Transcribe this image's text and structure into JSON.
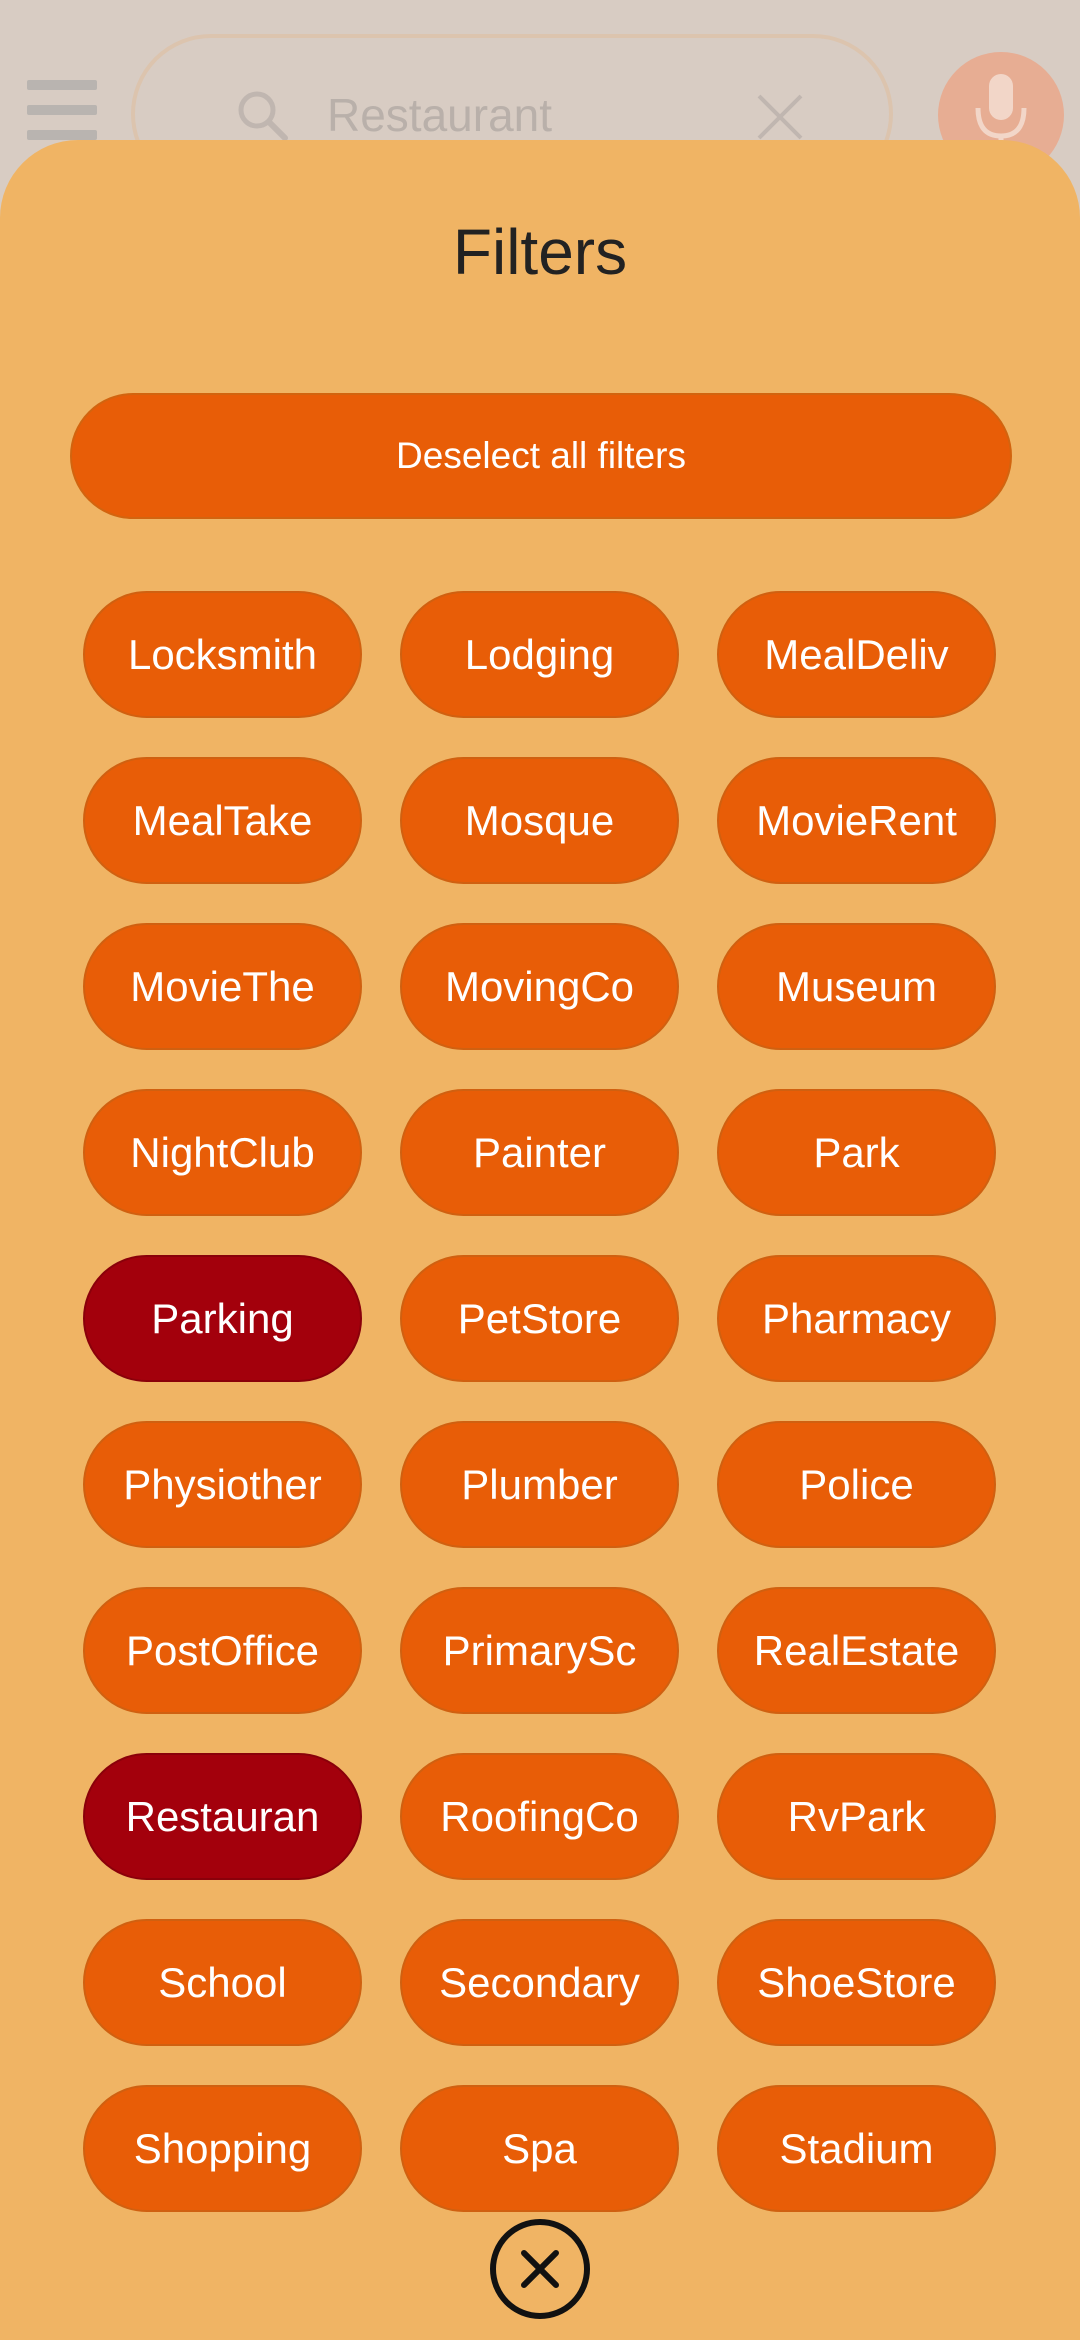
{
  "search": {
    "value": "Restaurant"
  },
  "sheet": {
    "title": "Filters",
    "deselect_label": "Deselect all filters"
  },
  "filters": [
    {
      "label": "Locksmith",
      "selected": false
    },
    {
      "label": "Lodging",
      "selected": false
    },
    {
      "label": "MealDeliv",
      "selected": false
    },
    {
      "label": "MealTake",
      "selected": false
    },
    {
      "label": "Mosque",
      "selected": false
    },
    {
      "label": "MovieRent",
      "selected": false
    },
    {
      "label": "MovieThe",
      "selected": false
    },
    {
      "label": "MovingCo",
      "selected": false
    },
    {
      "label": "Museum",
      "selected": false
    },
    {
      "label": "NightClub",
      "selected": false
    },
    {
      "label": "Painter",
      "selected": false
    },
    {
      "label": "Park",
      "selected": false
    },
    {
      "label": "Parking",
      "selected": true
    },
    {
      "label": "PetStore",
      "selected": false
    },
    {
      "label": "Pharmacy",
      "selected": false
    },
    {
      "label": "Physiother",
      "selected": false
    },
    {
      "label": "Plumber",
      "selected": false
    },
    {
      "label": "Police",
      "selected": false
    },
    {
      "label": "PostOffice",
      "selected": false
    },
    {
      "label": "PrimarySc",
      "selected": false
    },
    {
      "label": "RealEstate",
      "selected": false
    },
    {
      "label": "Restauran",
      "selected": true
    },
    {
      "label": "RoofingCo",
      "selected": false
    },
    {
      "label": "RvPark",
      "selected": false
    },
    {
      "label": "School",
      "selected": false
    },
    {
      "label": "Secondary",
      "selected": false
    },
    {
      "label": "ShoeStore",
      "selected": false
    },
    {
      "label": "Shopping",
      "selected": false
    },
    {
      "label": "Spa",
      "selected": false
    },
    {
      "label": "Stadium",
      "selected": false
    }
  ],
  "colors": {
    "sheet_background": "#f0b464",
    "chip": "#e85d07",
    "chip_selected": "#a3000c",
    "chip_text": "#ffffff"
  },
  "icons": {
    "menu": "menu-icon",
    "search": "search-icon",
    "clear": "close-icon",
    "mic": "microphone-icon",
    "close_sheet": "close-circle-icon"
  }
}
